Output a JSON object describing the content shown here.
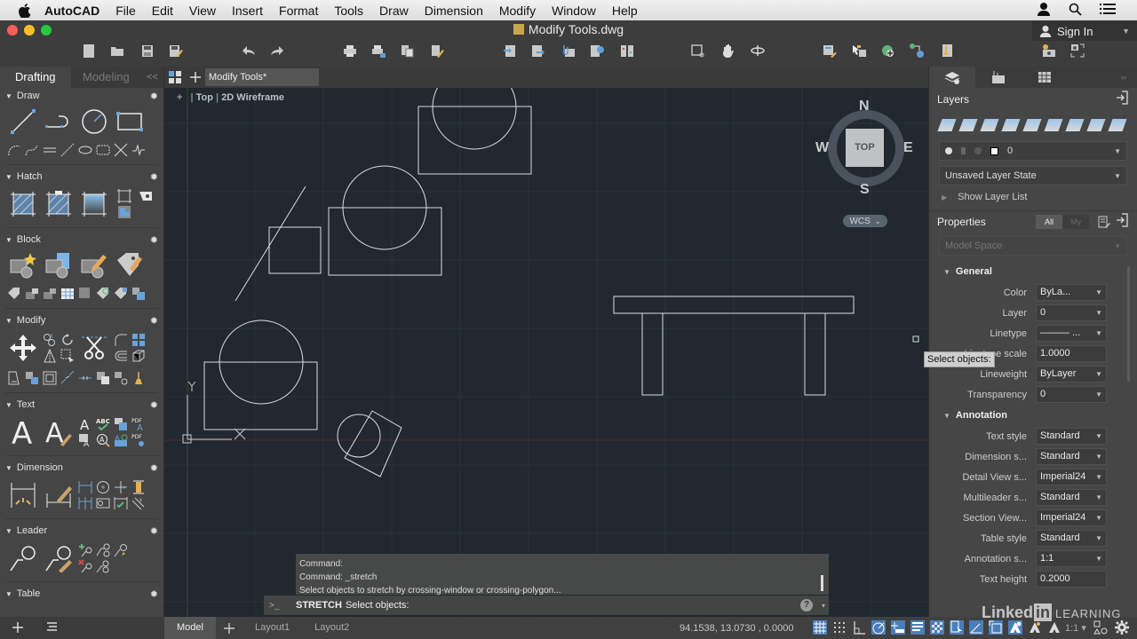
{
  "menubar": {
    "app_name": "AutoCAD",
    "items": [
      "File",
      "Edit",
      "View",
      "Insert",
      "Format",
      "Tools",
      "Draw",
      "Dimension",
      "Modify",
      "Window",
      "Help"
    ]
  },
  "window": {
    "title": "Modify Tools.dwg",
    "sign_in": "Sign In"
  },
  "left_palette": {
    "tabs": [
      "Drafting",
      "Modeling"
    ],
    "collapse_label": "<<",
    "sections": [
      "Draw",
      "Hatch",
      "Block",
      "Modify",
      "Text",
      "Dimension",
      "Leader",
      "Table"
    ]
  },
  "document": {
    "tab_label": "Modify Tools*",
    "viewport_view": "Top",
    "viewport_style": "2D Wireframe"
  },
  "viewcube": {
    "north": "N",
    "south": "S",
    "east": "E",
    "west": "W",
    "face": "TOP",
    "ucs": "WCS"
  },
  "ucs_icon": {
    "x_label": "X",
    "y_label": "Y"
  },
  "command_line": {
    "history": [
      "Command:",
      "Command: _stretch",
      "Select objects to stretch by crossing-window or crossing-polygon..."
    ],
    "prompt_icon": ">_",
    "current_command": "STRETCH",
    "current_prompt": "Select objects:",
    "help": "?"
  },
  "cursor_tooltip": "Select objects:",
  "statusbar": {
    "layout_tabs": [
      "Model",
      "Layout1",
      "Layout2"
    ],
    "active_tab": "Model",
    "coordinates": "94.1538, 13.0730 , 0.0000",
    "annotation_scale": "1:1"
  },
  "right_palette": {
    "layers": {
      "title": "Layers",
      "current_layer": "0",
      "layer_state": "Unsaved Layer State",
      "show_list": "Show Layer List"
    },
    "properties": {
      "title": "Properties",
      "filter_all": "All",
      "filter_my": "My",
      "selection": "Model Space",
      "general_title": "General",
      "general": [
        {
          "label": "Color",
          "value": "ByLa..."
        },
        {
          "label": "Layer",
          "value": "0"
        },
        {
          "label": "Linetype",
          "value": "——— ..."
        },
        {
          "label": "Linetype scale",
          "value": "1.0000"
        },
        {
          "label": "Lineweight",
          "value": "ByLayer"
        },
        {
          "label": "Transparency",
          "value": "0"
        }
      ],
      "annotation_title": "Annotation",
      "annotation": [
        {
          "label": "Text style",
          "value": "Standard"
        },
        {
          "label": "Dimension s...",
          "value": "Standard"
        },
        {
          "label": "Detail View s...",
          "value": "Imperial24"
        },
        {
          "label": "Multileader s...",
          "value": "Standard"
        },
        {
          "label": "Section View...",
          "value": "Imperial24"
        },
        {
          "label": "Table style",
          "value": "Standard"
        },
        {
          "label": "Annotation s...",
          "value": "1:1"
        },
        {
          "label": "Text height",
          "value": "0.2000"
        }
      ]
    }
  },
  "watermarks": {
    "linkedin": "Linked",
    "linkedin_in": "in",
    "learning": "LEARNING"
  },
  "colors": {
    "canvas_bg": "#212830",
    "panel_bg": "#464646",
    "accent_blue": "#4a7eb8",
    "geometry": "#d8dde2"
  }
}
